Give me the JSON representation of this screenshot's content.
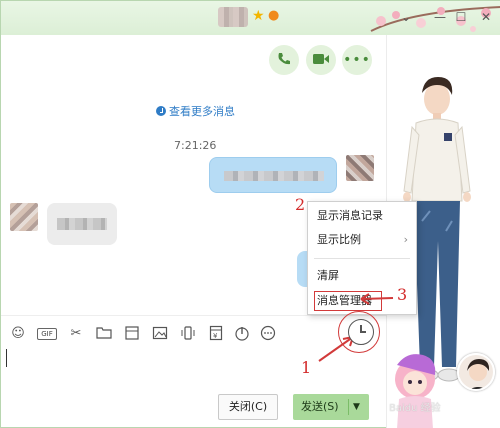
{
  "titlebar": {
    "star_icon": "star-icon",
    "flame_icon": "flame-icon",
    "controls": [
      "chevron-down-icon",
      "minimize-icon",
      "maximize-icon",
      "close-icon"
    ]
  },
  "chat": {
    "more_history": "查看更多消息",
    "timestamp": "7:21:26"
  },
  "context_menu": {
    "items": [
      {
        "label": "显示消息记录"
      },
      {
        "label": "显示比例",
        "submenu_arrow": "›"
      },
      {
        "label": "清屏"
      },
      {
        "label": "消息管理器"
      }
    ]
  },
  "annotations": {
    "one": "1",
    "two": "2",
    "three": "3"
  },
  "toolbar": {
    "gif_label": "GIF",
    "icons": [
      "emoji-icon",
      "gif-icon",
      "scissors-icon",
      "folder-icon",
      "image-icon",
      "shake-icon",
      "red-packet-icon",
      "audio-icon",
      "more-icon",
      "history-clock-icon"
    ]
  },
  "footer": {
    "close_label": "关闭(C)",
    "send_label": "发送(S)",
    "send_dropdown": "▼"
  },
  "watermark": "Baidu 经验",
  "colors": {
    "accent_green": "#a9d99a",
    "annotation_red": "#d23a3a",
    "bubble_blue": "#b7dcf5",
    "link_blue": "#2f7cc6"
  }
}
